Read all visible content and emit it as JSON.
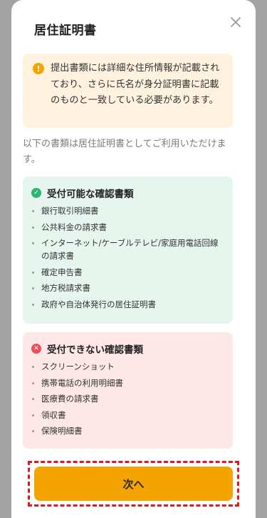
{
  "modal": {
    "title": "居住証明書",
    "close_icon": "close-icon"
  },
  "notice": {
    "icon": "exclamation-icon",
    "text": "提出書類には詳細な住所情報が記載されており、さらに氏名が身分証明書に記載のものと一致している必要があります。"
  },
  "intro": "以下の書類は居住証明書としてご利用いただけます。",
  "accepted": {
    "icon": "check-circle-icon",
    "title": "受付可能な確認書類",
    "items": [
      "銀行取引明細書",
      "公共料金の請求書",
      "インターネット/ケーブルテレビ/家庭用電話回線の請求書",
      "確定申告書",
      "地方税請求書",
      "政府や自治体発行の居住証明書"
    ]
  },
  "rejected": {
    "icon": "x-circle-icon",
    "title": "受付できない確認書類",
    "items": [
      "スクリーンショット",
      "携帯電話の利用明細書",
      "医療費の請求書",
      "領収書",
      "保険明細書"
    ]
  },
  "footer": {
    "next_label": "次へ"
  },
  "colors": {
    "accent": "#f5a300",
    "success": "#2bb673",
    "danger": "#e8505b",
    "highlight_border": "#e0191e"
  }
}
